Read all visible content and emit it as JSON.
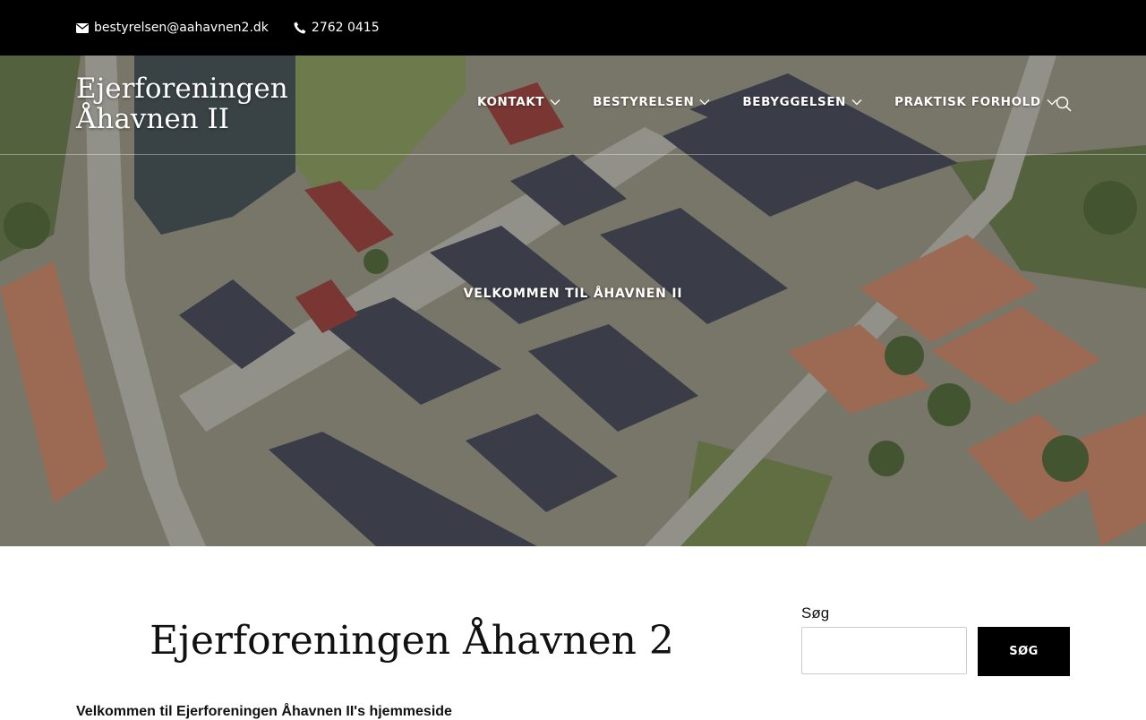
{
  "topbar": {
    "email": "bestyrelsen@aahavnen2.dk",
    "phone": "2762 0415",
    "email_icon": "envelope-icon",
    "phone_icon": "phone-icon"
  },
  "header": {
    "site_title": "Ejerforeningen Åhavnen II",
    "nav": [
      {
        "label": "KONTAKT",
        "icon": "chevron-down-icon"
      },
      {
        "label": "BESTYRELSEN",
        "icon": "chevron-down-icon"
      },
      {
        "label": "BEBYGGELSEN",
        "icon": "chevron-down-icon"
      },
      {
        "label": "PRAKTISK FORHOLD",
        "icon": "chevron-down-icon"
      }
    ],
    "search_icon": "search-icon"
  },
  "hero": {
    "title": "VELKOMMEN TIL ÅHAVNEN II"
  },
  "main": {
    "heading": "Ejerforeningen Åhavnen 2",
    "intro": "Velkommen til Ejerforeningen Åhavnen II's hjemmeside"
  },
  "sidebar": {
    "search_label": "Søg",
    "search_value": "",
    "search_button": "SØG"
  },
  "colors": {
    "topbar_bg": "#000000",
    "button_bg": "#000000",
    "text": "#111111"
  }
}
